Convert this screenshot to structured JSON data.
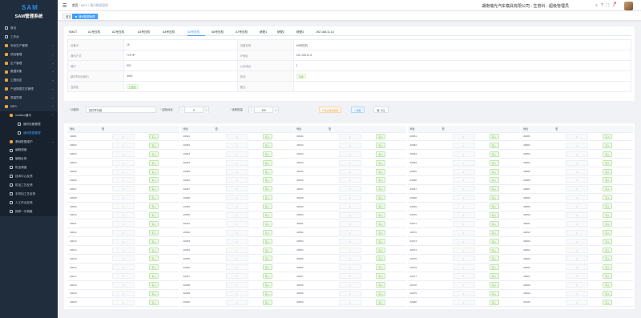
{
  "app": {
    "title": "SAM管理系统",
    "logo_text": "SAM"
  },
  "sidebar": {
    "items": [
      {
        "label": "首页",
        "icon": "home-icon"
      },
      {
        "label": "工作台",
        "icon": "desk-icon"
      },
      {
        "label": "安全生产管理",
        "icon": "folder-icon",
        "arrow": "⌄"
      },
      {
        "label": "项目管理",
        "icon": "folder-icon",
        "arrow": "⌄"
      },
      {
        "label": "生产管理",
        "icon": "folder-icon",
        "arrow": "⌄"
      },
      {
        "label": "数据采集",
        "icon": "folder-icon",
        "arrow": "⌄"
      },
      {
        "label": "工程设定",
        "icon": "folder-icon",
        "arrow": "⌄"
      },
      {
        "label": "产品数据文件管理",
        "icon": "folder-icon",
        "arrow": "⌄"
      },
      {
        "label": "质量异常",
        "icon": "folder-icon",
        "arrow": "⌄"
      },
      {
        "label": "MES",
        "icon": "folder-icon",
        "arrow": "⌃"
      },
      {
        "label": "modbus通讯",
        "icon": "folder-icon",
        "arrow": "⌃"
      },
      {
        "label": "通讯设备管理",
        "icon": "list-icon"
      },
      {
        "label": "通讯数据管理",
        "icon": "list-icon"
      },
      {
        "label": "基础数据维护",
        "icon": "folder-icon",
        "arrow": "⌄"
      },
      {
        "label": "编程调度",
        "icon": "doc-icon"
      },
      {
        "label": "编程反馈",
        "icon": "doc-icon"
      },
      {
        "label": "机加调度",
        "icon": "doc-icon"
      },
      {
        "label": "技术中心反馈",
        "icon": "doc-icon"
      },
      {
        "label": "机加工艺反馈",
        "icon": "doc-icon"
      },
      {
        "label": "手机加工艺反馈",
        "icon": "doc-icon"
      },
      {
        "label": "人工作业反馈",
        "icon": "doc-icon"
      },
      {
        "label": "报修一次调度",
        "icon": "doc-icon"
      }
    ]
  },
  "header": {
    "breadcrumb": [
      "首页",
      "MES",
      "通讯数据管理"
    ],
    "company": "湖南瑞光汽车模具有限公司 - 生管科 - 超级管理员",
    "badge": "6"
  },
  "tags": [
    {
      "label": "首页"
    },
    {
      "label": "通讯数据管理"
    }
  ],
  "device_tabs": [
    "SMDT",
    "A1号压机",
    "A2号压机",
    "A3号压机",
    "A4号压机",
    "A5号压机",
    "A6号压机",
    "A7号压机",
    "研配1",
    "研配2",
    "研配3",
    "192.168.11.14"
  ],
  "device_tab_active": 5,
  "info": {
    "rows": [
      [
        "设备ID",
        "15",
        "设备名称",
        "A5号压机"
      ],
      [
        "通讯方式",
        "TCP/IP",
        "IP地址",
        "192.168.11.5"
      ],
      [
        "端口",
        "502",
        "从站地址",
        "1"
      ],
      [
        "超时时间(毫秒)",
        "3000",
        "状态",
        "正常"
      ],
      [
        "连接性",
        "已连接",
        "备注",
        ""
      ]
    ]
  },
  "controls": {
    "func_label": "功能码",
    "func_value": "保持寄存器",
    "start_label": "起始地址",
    "start_value": "0",
    "count_label": "读取数量",
    "count_value": "100",
    "btn_stop": "停止自动读取",
    "btn_read": "读取",
    "btn_clear": "清空"
  },
  "table": {
    "col_addr": "地址",
    "col_value": "值",
    "write_label": "写入",
    "value_placeholder": "0",
    "addresses": [
      [
        "40001",
        "40002",
        "40003",
        "40004",
        "40005",
        "40006",
        "40007",
        "40008",
        "40009",
        "40010",
        "40011",
        "40012",
        "40013",
        "40014",
        "40015",
        "40016",
        "40017",
        "40018",
        "40019",
        "40020"
      ],
      [
        "40021",
        "40022",
        "40023",
        "40024",
        "40025",
        "40026",
        "40027",
        "40028",
        "40029",
        "40030",
        "40031",
        "40032",
        "40033",
        "40034",
        "40035",
        "40036",
        "40037",
        "40038",
        "40039",
        "40040"
      ],
      [
        "40041",
        "40042",
        "40043",
        "40044",
        "40045",
        "40046",
        "40047",
        "40048",
        "40049",
        "40050",
        "40051",
        "40052",
        "40053",
        "40054",
        "40055",
        "40056",
        "40057",
        "40058",
        "40059",
        "40060"
      ],
      [
        "40061",
        "40062",
        "40063",
        "40064",
        "40065",
        "40066",
        "40067",
        "40068",
        "40069",
        "40070",
        "40071",
        "40072",
        "40073",
        "40074",
        "40075",
        "40076",
        "40077",
        "40078",
        "40079",
        "40080"
      ],
      [
        "40081",
        "40082",
        "40083",
        "40084",
        "40085",
        "40086",
        "40087",
        "40088",
        "40089",
        "40090",
        "40091",
        "40092",
        "40093",
        "40094",
        "40095",
        "40096",
        "40097",
        "40098",
        "40099",
        "40100"
      ]
    ]
  },
  "colors": {
    "sidebar_bg": "#1f2d3d",
    "accent": "#409eff",
    "success": "#67c23a"
  }
}
